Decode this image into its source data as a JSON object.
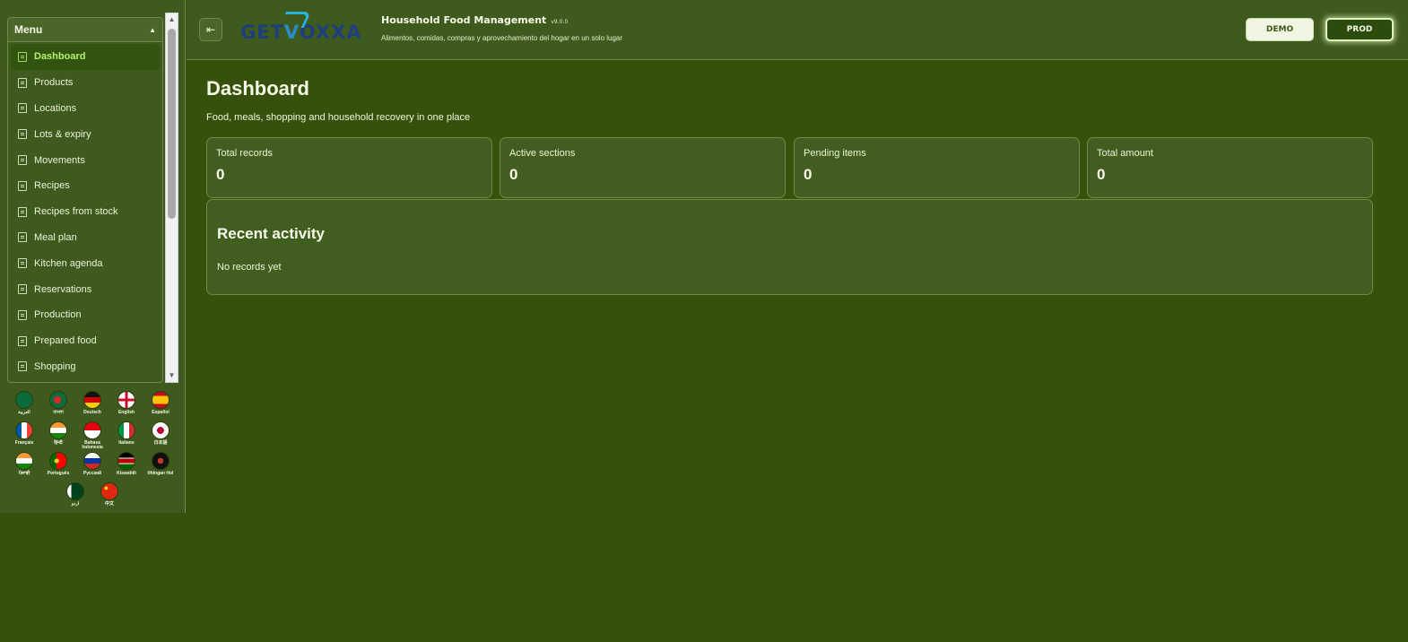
{
  "sidebar": {
    "menu_title": "Menu",
    "collapse_glyph": "▲",
    "items": [
      {
        "label": "Dashboard",
        "active": true,
        "icon": "list-icon"
      },
      {
        "label": "Products",
        "icon": "list-icon"
      },
      {
        "label": "Locations",
        "icon": "list-icon"
      },
      {
        "label": "Lots & expiry",
        "icon": "list-icon"
      },
      {
        "label": "Movements",
        "icon": "list-icon"
      },
      {
        "label": "Recipes",
        "icon": "list-icon"
      },
      {
        "label": "Recipes from stock",
        "icon": "list-icon"
      },
      {
        "label": "Meal plan",
        "icon": "list-icon"
      },
      {
        "label": "Kitchen agenda",
        "icon": "list-icon"
      },
      {
        "label": "Reservations",
        "icon": "list-icon"
      },
      {
        "label": "Production",
        "icon": "list-icon"
      },
      {
        "label": "Prepared food",
        "icon": "list-icon"
      },
      {
        "label": "Shopping",
        "icon": "list-icon"
      }
    ],
    "languages": [
      {
        "label": "العربية",
        "flag": "linear-gradient(#0b6b3a,#0b6b3a)"
      },
      {
        "label": "বাংলা",
        "flag": "radial-gradient(circle at 45% 50%, #d62828 0 30%, #0b6b3a 31%)"
      },
      {
        "label": "Deutsch",
        "flag": "linear-gradient(#111 0 33%, #d40000 33% 66%, #ffce00 66%)"
      },
      {
        "label": "English",
        "flag": "linear-gradient(0deg, transparent 42%, #c8102e 42% 58%, transparent 58%), linear-gradient(90deg, transparent 42%, #c8102e 42% 58%, transparent 58%), linear-gradient(#ffffff,#ffffff) , #012169"
      },
      {
        "label": "Español",
        "flag": "linear-gradient(#c60b1e 0 25%, #ffc400 25% 75%, #c60b1e 75%)"
      },
      {
        "label": "Français",
        "flag": "linear-gradient(90deg, #0055a4 0 33%, #fff 33% 66%, #ef4135 66%)"
      },
      {
        "label": "हिन्दी",
        "flag": "linear-gradient(#ff9933 0 33%, #fff 33% 66%, #138808 66%)"
      },
      {
        "label": "Bahasa Indonesia",
        "flag": "linear-gradient(#e70011 0 50%, #fff 50%)"
      },
      {
        "label": "Italiano",
        "flag": "linear-gradient(90deg, #009246 0 33%, #fff 33% 66%, #ce2b37 66%)"
      },
      {
        "label": "日本語",
        "flag": "radial-gradient(circle, #bc002d 0 30%, #fff 31%)"
      },
      {
        "label": "ਪੰਜਾਬੀ",
        "flag": "linear-gradient(#ff9933 0 33%, #fff 33% 66%, #138808 66%)"
      },
      {
        "label": "Português",
        "flag": "radial-gradient(circle at 40% 50%, #ffcc29 0 18%, transparent 19%), linear-gradient(90deg, #006600 0 40%, #ff0000 40%)"
      },
      {
        "label": "Русский",
        "flag": "linear-gradient(#fff 0 33%, #0039a6 33% 66%, #d52b1e 66%)"
      },
      {
        "label": "Kiswahili",
        "flag": "linear-gradient(#000 0 30%, #fff 30% 35%, #bb0000 35% 65%, #fff 65% 70%, #006600 70%)"
      },
      {
        "label": "tlhIngan Hol",
        "flag": "radial-gradient(circle, #c0392b 0 25%, #111 26%)"
      },
      {
        "label": "اردو",
        "flag": "linear-gradient(90deg, #fff 0 25%, #01411c 25%)"
      },
      {
        "label": "中文",
        "flag": "radial-gradient(circle at 30% 30%, #ffde00 0 10%, #de2910 11%)"
      }
    ]
  },
  "header": {
    "toggle_glyph": "⇤",
    "logo_text_left": "GET",
    "logo_text_v": "V",
    "logo_text_right": "OXXA",
    "title": "Household Food Management",
    "version": "v9.0.0",
    "subtitle": "Alimentos, comidas, compras y aprovechamiento del hogar en un solo lugar",
    "demo_label": "DEMO",
    "prod_label": "PROD"
  },
  "main": {
    "title": "Dashboard",
    "subtitle": "Food, meals, shopping and household recovery in one place",
    "stats": [
      {
        "label": "Total records",
        "value": "0"
      },
      {
        "label": "Active sections",
        "value": "0"
      },
      {
        "label": "Pending items",
        "value": "0"
      },
      {
        "label": "Total amount",
        "value": "0"
      }
    ],
    "activity_title": "Recent activity",
    "activity_empty": "No records yet"
  }
}
